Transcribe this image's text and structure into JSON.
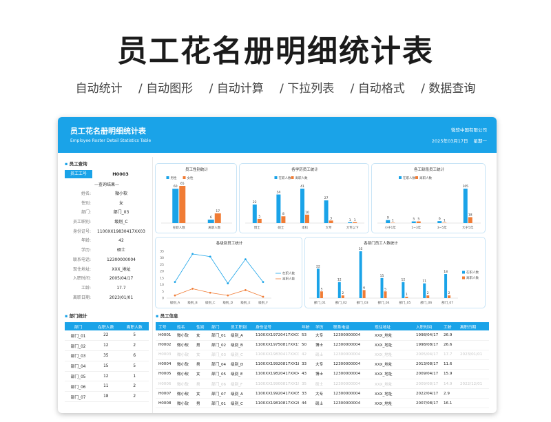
{
  "hero": {
    "title": "员工花名册明细统计表",
    "features": [
      "自动统计",
      "/ 自动图形",
      "/ 自动计算",
      "/ 下拉列表",
      "/ 自动格式",
      "/ 数据查询"
    ]
  },
  "colors": {
    "accent": "#1aa3e8",
    "orange": "#f07c35"
  },
  "banner": {
    "title": "员工花名册明细统计表",
    "subtitle": "Employee Roster Detail Statistics Table",
    "company": "微软中国有限公司",
    "date": "2025年03月17日",
    "weekday": "星期一"
  },
  "query": {
    "section": "员工查询",
    "label": "员工工号",
    "value": "H0003",
    "result_title": "—查询结果—",
    "fields": [
      {
        "k": "姓名:",
        "v": "微小软"
      },
      {
        "k": "性别:",
        "v": "女"
      },
      {
        "k": "部门:",
        "v": "部门_03"
      },
      {
        "k": "员工职别:",
        "v": "级别_C"
      },
      {
        "k": "身份证号:",
        "v": "1100XX19830417XX03"
      },
      {
        "k": "年龄:",
        "v": "42"
      },
      {
        "k": "学历:",
        "v": "硕士"
      },
      {
        "k": "联系电话:",
        "v": "12300000004"
      },
      {
        "k": "现住地址:",
        "v": "XXX_地址"
      },
      {
        "k": "入职时间:",
        "v": "2005/04/17"
      },
      {
        "k": "工龄:",
        "v": "17.7"
      },
      {
        "k": "离职日期:",
        "v": "2023/01/01"
      }
    ]
  },
  "dept": {
    "section": "部门统计",
    "headers": [
      "部门",
      "在职人数",
      "离职人数"
    ],
    "rows": [
      [
        "部门_01",
        "22",
        "5"
      ],
      [
        "部门_02",
        "12",
        "2"
      ],
      [
        "部门_03",
        "35",
        "6"
      ],
      [
        "部门_04",
        "15",
        "5"
      ],
      [
        "部门_05",
        "12",
        "1"
      ],
      [
        "部门_06",
        "11",
        "2"
      ],
      [
        "部门_07",
        "18",
        "2"
      ]
    ]
  },
  "chart_data": [
    {
      "type": "bar",
      "title": "员工性别统计",
      "categories": [
        "在职人数",
        "离职人数"
      ],
      "series": [
        {
          "name": "男性",
          "values": [
            60,
            6
          ]
        },
        {
          "name": "女性",
          "values": [
            65,
            17
          ]
        }
      ]
    },
    {
      "type": "bar",
      "title": "各学历员工统计",
      "categories": [
        "博士",
        "硕士",
        "本科",
        "大专",
        "大专以下"
      ],
      "series": [
        {
          "name": "在职人数",
          "values": [
            22,
            34,
            41,
            27,
            1
          ]
        },
        {
          "name": "离职人数",
          "values": [
            5,
            8,
            10,
            3,
            1
          ]
        }
      ]
    },
    {
      "type": "bar",
      "title": "各工龄段员工统计",
      "categories": [
        "小于1年",
        "1~3年",
        "3~5年",
        "大于5年"
      ],
      "series": [
        {
          "name": "在职人数",
          "values": [
            9,
            5,
            6,
            105
          ]
        },
        {
          "name": "离职人数",
          "values": [
            1,
            5,
            1,
            18
          ]
        }
      ]
    },
    {
      "type": "line",
      "title": "各级别员工统计",
      "categories": [
        "级别_A",
        "级别_B",
        "级别_C",
        "级别_D",
        "级别_E",
        "级别_F"
      ],
      "ylim": [
        0,
        35
      ],
      "yticks": [
        "0",
        "5",
        "10",
        "15",
        "20",
        "25",
        "30",
        "35"
      ],
      "series": [
        {
          "name": "在职人数",
          "values": [
            12,
            33,
            31,
            11,
            29,
            12
          ]
        },
        {
          "name": "离职人数",
          "values": [
            2,
            7,
            4,
            2,
            6,
            1
          ]
        }
      ]
    },
    {
      "type": "bar",
      "title": "各部门员工人数统计",
      "categories": [
        "部门_01",
        "部门_02",
        "部门_03",
        "部门_04",
        "部门_05",
        "部门_06",
        "部门_07"
      ],
      "series": [
        {
          "name": "在职人数",
          "values": [
            22,
            12,
            35,
            15,
            12,
            11,
            18
          ]
        },
        {
          "name": "离职人数",
          "values": [
            5,
            2,
            6,
            5,
            1,
            2,
            2
          ]
        }
      ]
    }
  ],
  "employees": {
    "section": "员工信息",
    "headers": [
      "工号",
      "姓名",
      "性别",
      "部门",
      "员工职别",
      "身份证号",
      "年龄",
      "学历",
      "联系电话",
      "现住地址",
      "入职时间",
      "工龄",
      "离职日期"
    ],
    "rows": [
      {
        "faded": false,
        "cells": [
          "H0001",
          "微小软",
          "女",
          "部门_01",
          "级别_A",
          "1100XX19720417XX01",
          "53",
          "大专",
          "12300000004",
          "XXX_地址",
          "1998/04/17",
          "26.9",
          ""
        ]
      },
      {
        "faded": false,
        "cells": [
          "H0002",
          "微小软",
          "男",
          "部门_02",
          "级别_B",
          "1100XX19750817XX17",
          "50",
          "博士",
          "12300000004",
          "XXX_地址",
          "1998/08/17",
          "26.6",
          ""
        ]
      },
      {
        "faded": true,
        "cells": [
          "H0003",
          "微小软",
          "女",
          "部门_03",
          "级别_C",
          "1100XX19830417XX03",
          "42",
          "硕士",
          "12300000004",
          "XXX_地址",
          "2005/04/17",
          "17.7",
          "2023/01/01"
        ]
      },
      {
        "faded": false,
        "cells": [
          "H0004",
          "微小软",
          "男",
          "部门_04",
          "级别_D",
          "1100XX19920817XX18",
          "33",
          "大专",
          "12300000004",
          "XXX_地址",
          "2013/08/17",
          "11.6",
          ""
        ]
      },
      {
        "faded": false,
        "cells": [
          "H0005",
          "微小软",
          "女",
          "部门_05",
          "级别_E",
          "1100XX19820417XX04",
          "43",
          "博士",
          "12300000004",
          "XXX_地址",
          "2009/04/17",
          "15.9",
          ""
        ]
      },
      {
        "faded": true,
        "cells": [
          "H0006",
          "微小软",
          "男",
          "部门_06",
          "级别_F",
          "1100XX19900817XX19",
          "35",
          "硕士",
          "12300000004",
          "XXX_地址",
          "2009/08/17",
          "14.9",
          "2022/12/01"
        ]
      },
      {
        "faded": false,
        "cells": [
          "H0007",
          "微小软",
          "女",
          "部门_07",
          "级别_A",
          "1100XX19920417XX05",
          "33",
          "大专",
          "12300000004",
          "XXX_地址",
          "2022/04/17",
          "2.9",
          ""
        ]
      },
      {
        "faded": false,
        "cells": [
          "H0008",
          "微小软",
          "男",
          "部门_01",
          "级别_C",
          "1100XX19810817XX20",
          "44",
          "硕士",
          "12300000004",
          "XXX_地址",
          "2007/08/17",
          "16.1",
          ""
        ]
      }
    ]
  }
}
